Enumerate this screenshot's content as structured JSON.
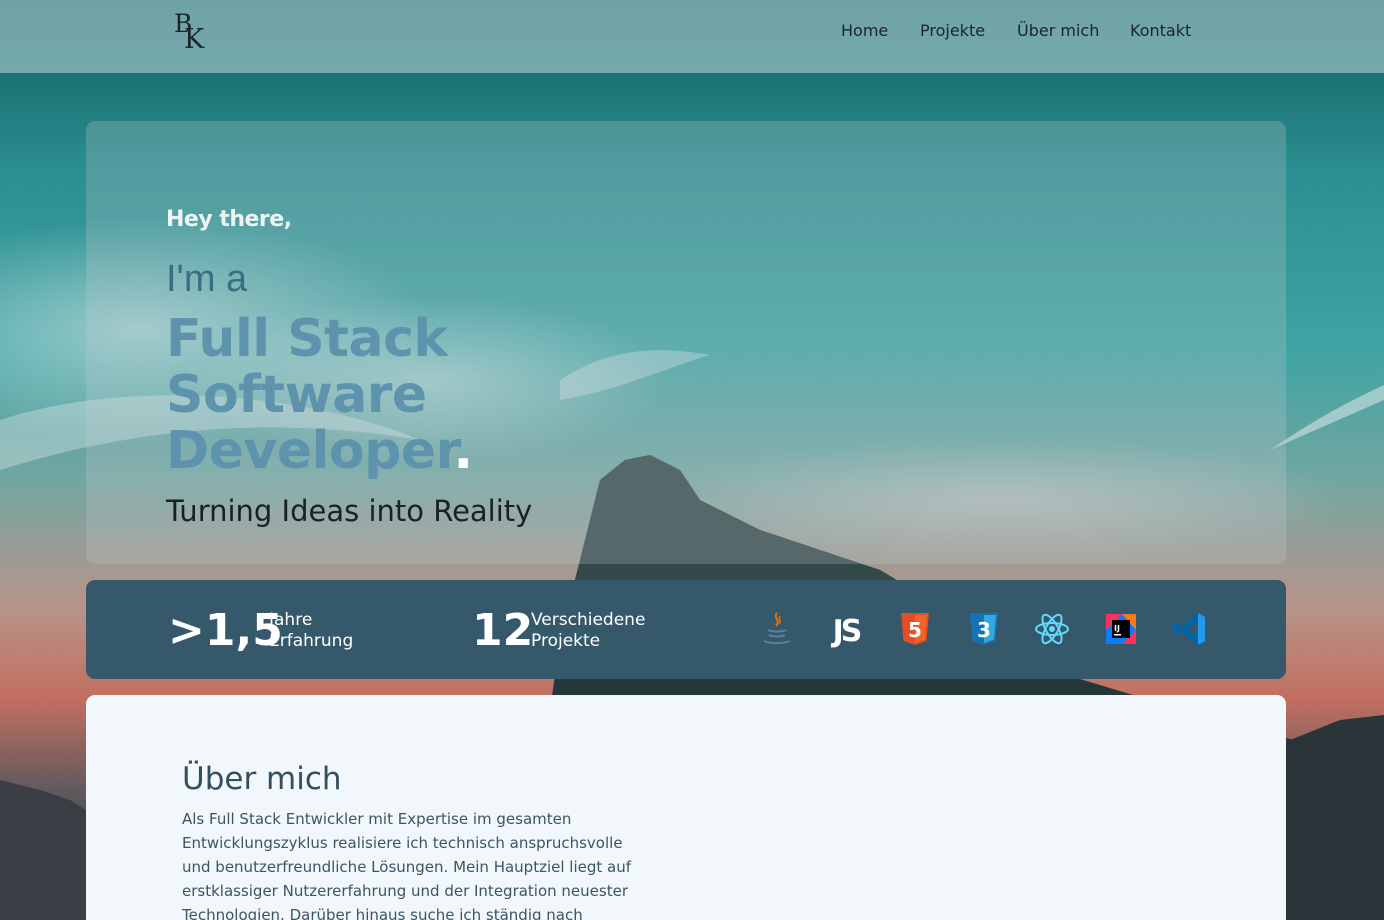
{
  "brand": {
    "logo_top": "B",
    "logo_bottom": "K"
  },
  "nav": {
    "items": [
      {
        "label": "Home"
      },
      {
        "label": "Projekte"
      },
      {
        "label": "Über mich"
      },
      {
        "label": "Kontakt"
      }
    ]
  },
  "hero": {
    "greeting": "Hey there,",
    "intro": "I'm a",
    "role_lines": [
      "Full Stack",
      "Software",
      "Developer"
    ],
    "role_dot": ".",
    "tagline": "Turning Ideas into Reality"
  },
  "stats": {
    "experience": {
      "value": ">1,5",
      "label_line1": "Jahre",
      "label_line2": "Erfahrung"
    },
    "projects": {
      "value": "12",
      "label_line1": "Verschiedene",
      "label_line2": "Projekte"
    }
  },
  "tech_icons": [
    "java-icon",
    "javascript-icon",
    "html5-icon",
    "css3-icon",
    "react-icon",
    "intellij-icon",
    "vscode-icon"
  ],
  "tech_text": {
    "js": "JS",
    "html": "5",
    "css": "3",
    "ij": "IJ"
  },
  "about": {
    "title": "Über mich",
    "text": "Als Full Stack Entwickler mit Expertise im gesamten Entwicklungszyklus realisiere ich technisch anspruchsvolle und benutzerfreundliche Lösungen. Mein Hauptziel liegt auf erstklassiger Nutzererfahrung und der Integration neuester Technologien. Darüber hinaus suche ich ständig nach"
  },
  "colors": {
    "navbar": "#96bec4",
    "stats_bar": "#35586b",
    "role_text": "#5e93ad",
    "about_bg": "#f1f7fa"
  }
}
